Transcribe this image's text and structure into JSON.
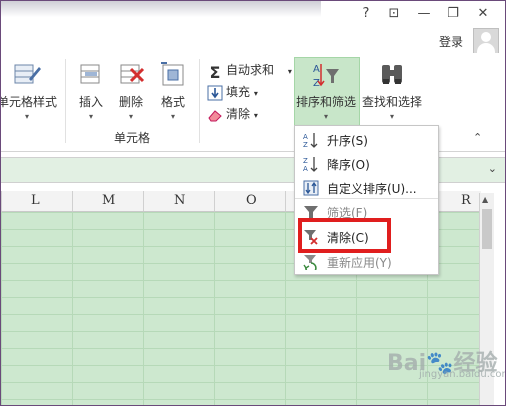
{
  "window": {
    "help": "?",
    "ribbon_display": "⊡",
    "minimize": "—",
    "restore": "❐",
    "close": "✕"
  },
  "account": {
    "login_label": "登录"
  },
  "ribbon": {
    "cell_styles_label": "单元格样式",
    "insert_label": "插入",
    "delete_label": "删除",
    "format_label": "格式",
    "cells_group_label": "单元格",
    "autosum_label": "自动求和",
    "fill_label": "填充",
    "clear_label": "清除",
    "sort_filter_label": "排序和筛选",
    "find_select_label": "查找和选择",
    "dropdown_glyph": "▾",
    "collapse_glyph": "⌃"
  },
  "formula_bar": {
    "expand_glyph": "⌄"
  },
  "columns": [
    "L",
    "M",
    "N",
    "O",
    "R"
  ],
  "sort_menu": {
    "items": [
      {
        "label": "升序(S)",
        "icon": "sort-ascending-icon"
      },
      {
        "label": "降序(O)",
        "icon": "sort-descending-icon"
      },
      {
        "label": "自定义排序(U)...",
        "icon": "custom-sort-icon"
      },
      {
        "label": "筛选(F)",
        "icon": "filter-icon"
      },
      {
        "label": "清除(C)",
        "icon": "clear-filter-icon"
      },
      {
        "label": "重新应用(Y)",
        "icon": "reapply-icon"
      }
    ]
  },
  "highlight_color": "#e01e1e",
  "selected_button_color": "#c8e6c9",
  "watermark": {
    "main": "Bai🐾经验",
    "sub": "jingyan.baidu.com"
  }
}
